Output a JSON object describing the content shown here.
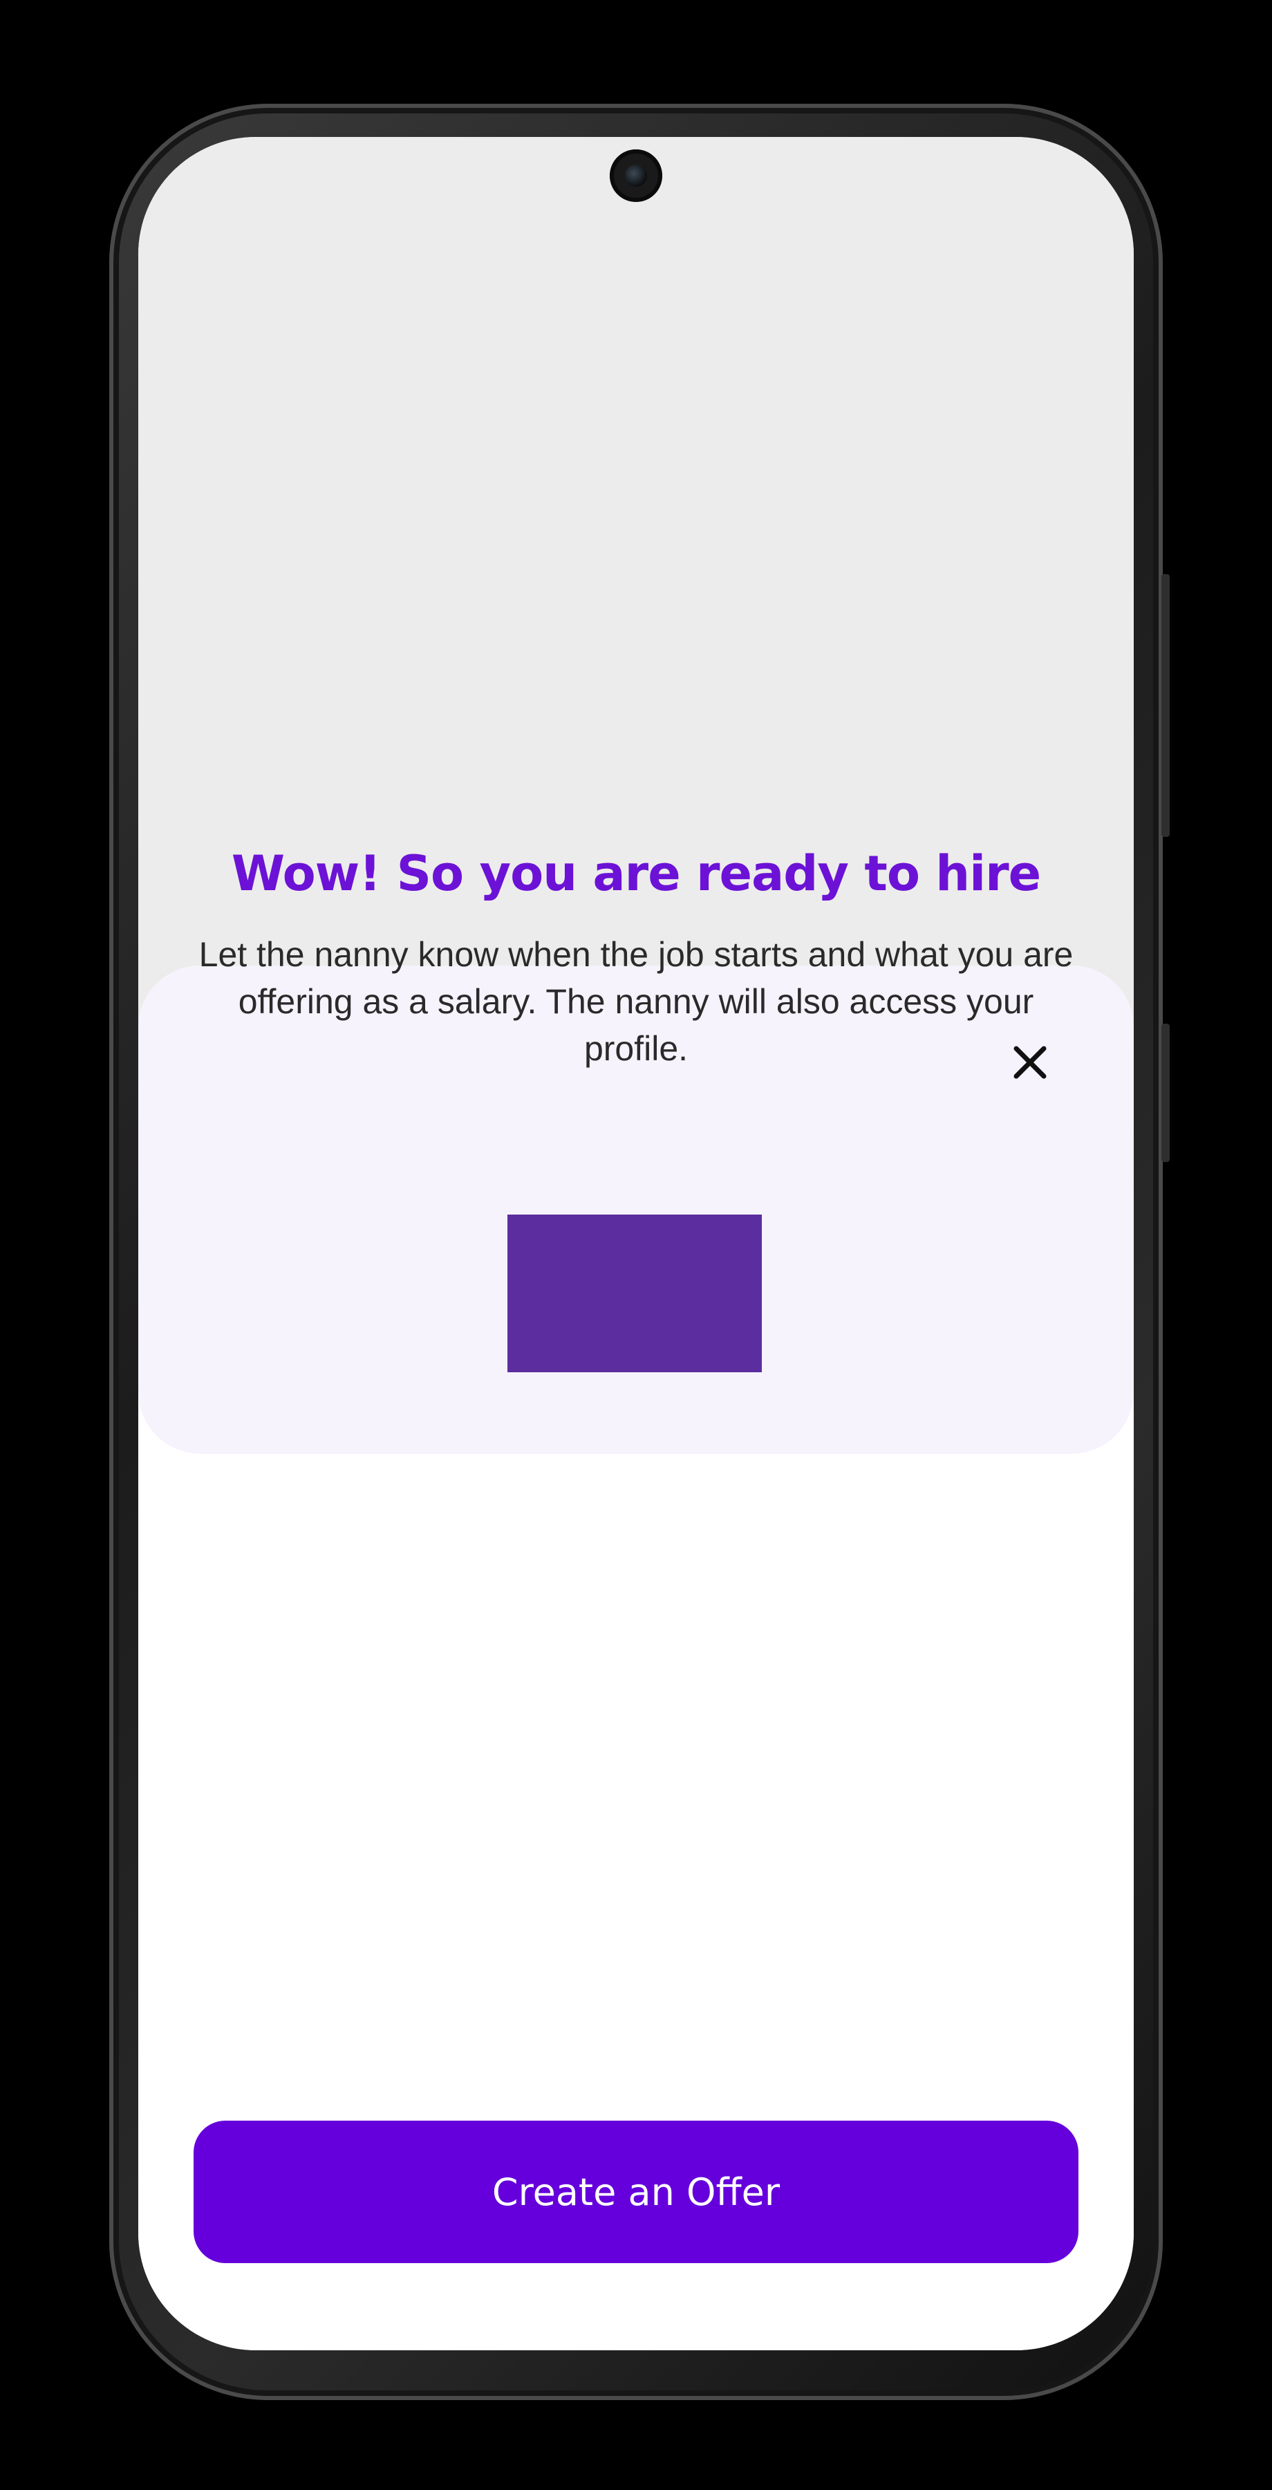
{
  "colors": {
    "accent": "#6500dc",
    "title": "#6c12d6",
    "hero_background": "#f6f3fd",
    "illustration": "#5c2d9f",
    "backdrop": "#ececec"
  },
  "sheet": {
    "close_icon": "close-icon",
    "title": "Wow! So you are ready to hire",
    "description": "Let the nanny know when the job starts and what you are offering as a salary. The nanny will also access your profile."
  },
  "actions": {
    "primary_label": "Create an Offer"
  }
}
